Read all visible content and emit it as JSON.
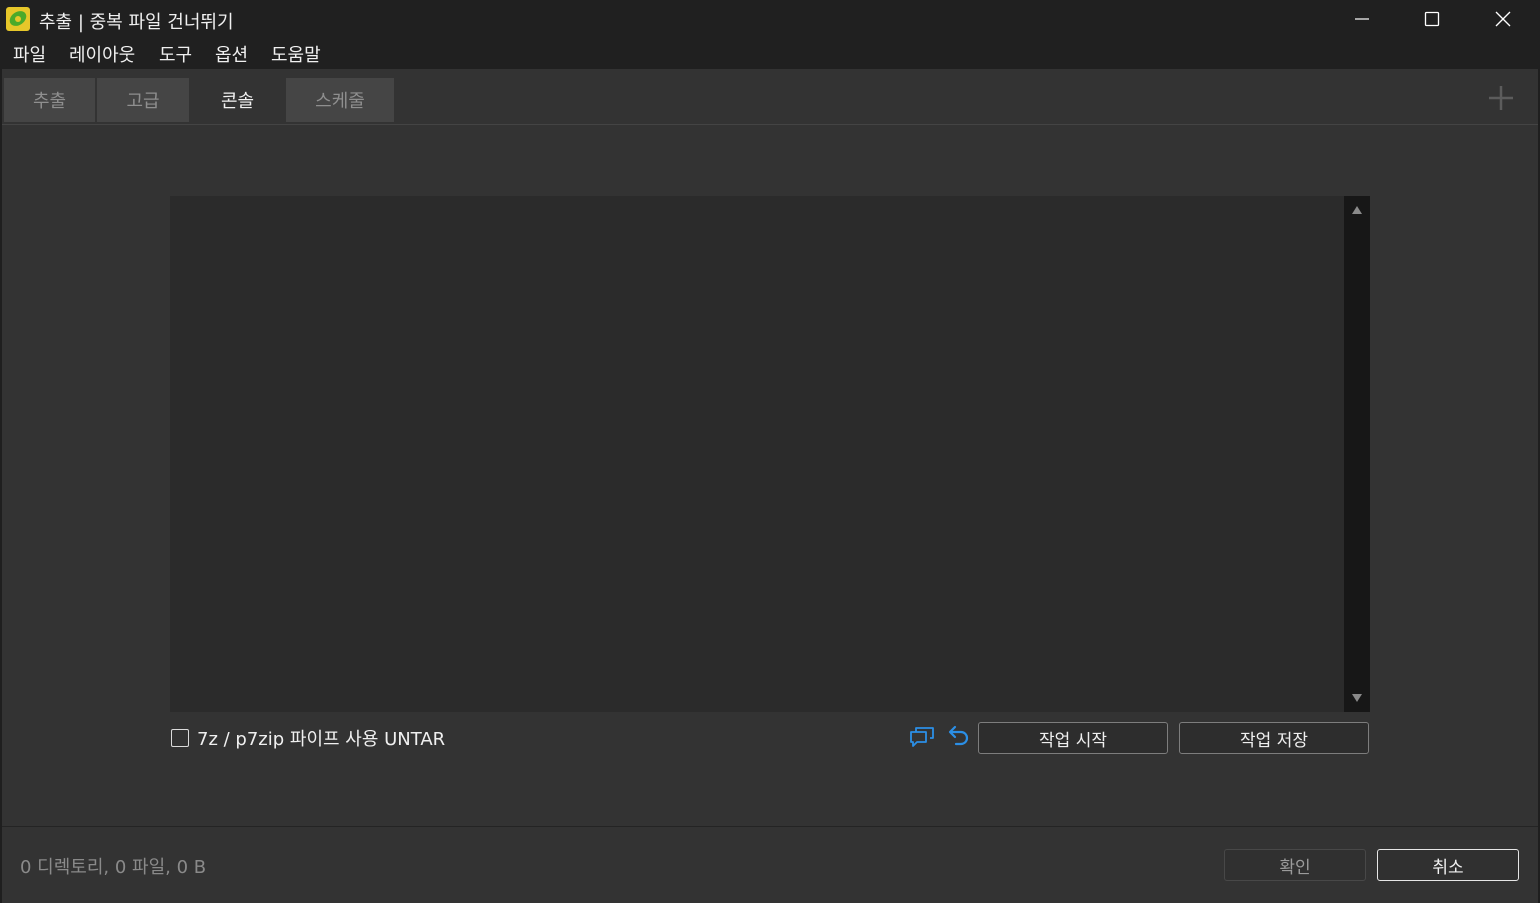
{
  "window": {
    "title": "추출 | 중복 파일 건너뛰기",
    "app_icon": "app-leaf-icon",
    "controls": [
      "minimize-icon",
      "maximize-icon",
      "close-icon"
    ]
  },
  "menubar": {
    "items": [
      "파일",
      "레이아웃",
      "도구",
      "옵션",
      "도움말"
    ]
  },
  "tabs": [
    {
      "label": "추출",
      "active": false
    },
    {
      "label": "고급",
      "active": false
    },
    {
      "label": "콘솔",
      "active": true
    },
    {
      "label": "스케줄",
      "active": false
    }
  ],
  "add_tab_icon": "plus-icon",
  "console": {
    "content": "",
    "scrollbar": {
      "up_icon": "arrow-up-icon",
      "down_icon": "arrow-down-icon"
    }
  },
  "options": {
    "pipe_checkbox": {
      "label": "7z / p7zip 파이프 사용 UNTAR",
      "checked": false
    }
  },
  "actions": {
    "chat_icon": "speech-bubbles-icon",
    "undo_icon": "undo-icon",
    "start_job_label": "작업 시작",
    "save_job_label": "작업 저장"
  },
  "footer": {
    "status": "0 디렉토리, 0 파일, 0 B",
    "ok_label": "확인",
    "cancel_label": "취소"
  },
  "colors": {
    "background": "#333333",
    "titlebar": "#202020",
    "console": "#2b2b2b",
    "accent_icon": "#2b8fe6"
  }
}
